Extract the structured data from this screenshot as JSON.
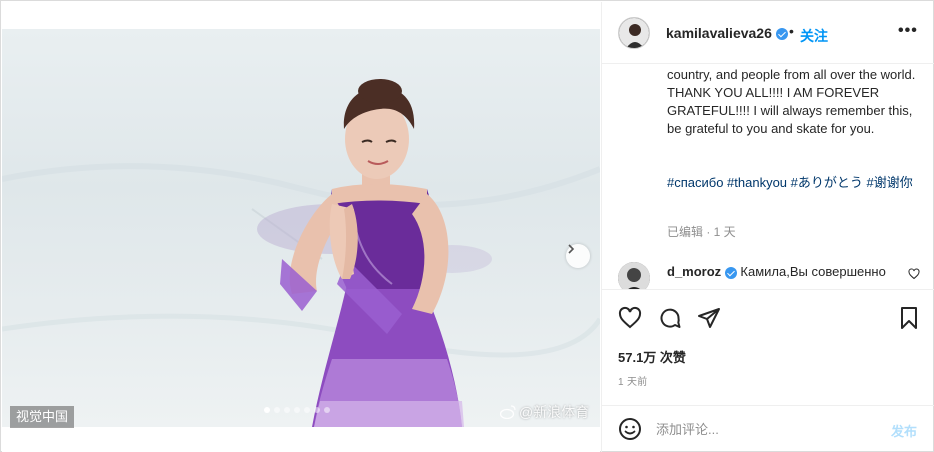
{
  "post": {
    "username": "kamilavalieva26",
    "separator": "•",
    "follow_label": "关注",
    "more_label": "•••",
    "caption_text": "country, and people from all over the world.\nTHANK YOU ALL!!!! I AM FOREVER GRATEFUL!!!! I will always remember this, be grateful to you and skate for you.",
    "hashtags": "#спасибо #thankyou #ありがとう #谢谢你",
    "edited_label": "已编辑 · 1 天",
    "likes": "57.1万 次赞",
    "time": "1 天前"
  },
  "comment": {
    "username": "d_moroz",
    "text": "Камила,Вы совершенно"
  },
  "media": {
    "watermark_left": "视觉中国",
    "watermark_right": "@新浪体育",
    "carousel_count": 7,
    "carousel_active": 0
  },
  "add_comment": {
    "placeholder": "添加评论...",
    "post_label": "发布"
  },
  "icons": {
    "verified": "verified-badge-icon",
    "like": "heart-icon",
    "comment": "comment-icon",
    "share": "paper-plane-icon",
    "save": "bookmark-icon",
    "emoji": "smiley-icon",
    "next": "chevron-right-icon"
  },
  "colors": {
    "accent": "#0095f6",
    "hashtag": "#00376b",
    "muted": "#8e8e8e",
    "verified": "#3897f0",
    "post_disabled": "#b2dffc"
  }
}
